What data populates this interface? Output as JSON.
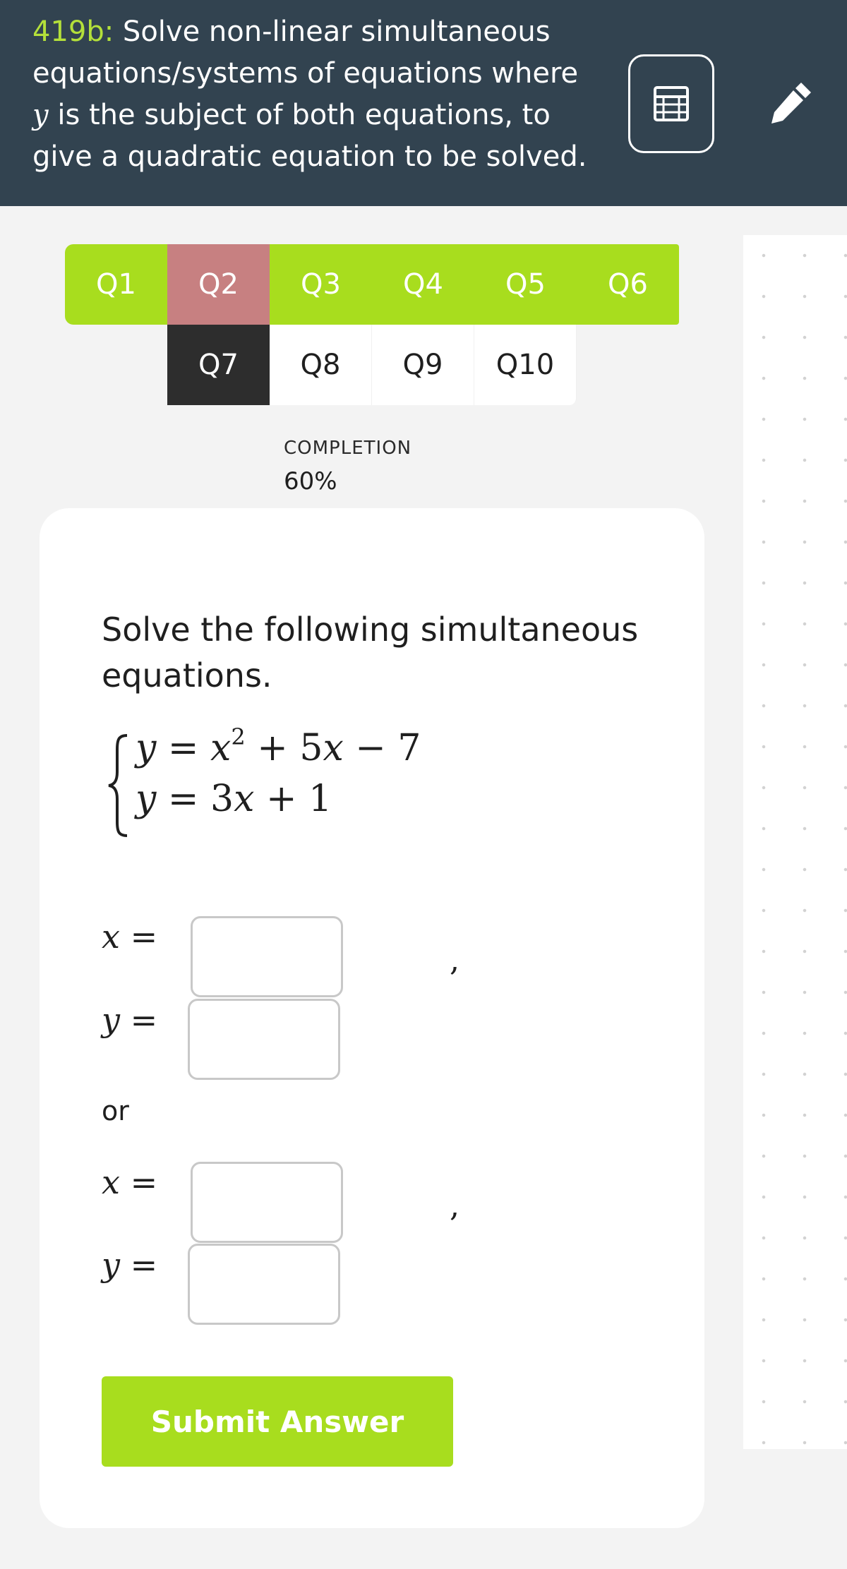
{
  "header": {
    "code": "419b:",
    "title_before_var": " Solve non-linear simultaneous equations/systems of equations where ",
    "title_var": "y",
    "title_after_var": " is the subject of both equations, to give a quadratic equation to be solved.",
    "calculator_icon": "calculator-icon",
    "pen_icon": "pen-icon"
  },
  "tabs": {
    "row1": [
      "Q1",
      "Q2",
      "Q3",
      "Q4",
      "Q5",
      "Q6"
    ],
    "row2": [
      "Q7",
      "Q8",
      "Q9",
      "Q10"
    ],
    "current": "Q2"
  },
  "completion": {
    "label": "COMPLETION",
    "value": "60%",
    "fraction": 0.6
  },
  "question": {
    "prompt": "Solve the following simultaneous equations.",
    "eq1": {
      "lhs": "y",
      "eq": " = ",
      "x": "x",
      "exp": "2",
      "rest1": " + 5",
      "x2": "x",
      "rest2": " − 7"
    },
    "eq2": {
      "lhs": "y",
      "eq": " = 3",
      "x": "x",
      "rest": " + 1"
    }
  },
  "answers": {
    "x_label": "x",
    "y_label": "y",
    "equals": " =",
    "comma": ",",
    "or": "or",
    "x1": "",
    "y1": "",
    "x2": "",
    "y2": ""
  },
  "submit_label": "Submit Answer",
  "colors": {
    "header_bg": "#324350",
    "accent_green": "#a8dd1e",
    "current_tab": "#c78081",
    "dark_tab": "#2d2d2d"
  }
}
